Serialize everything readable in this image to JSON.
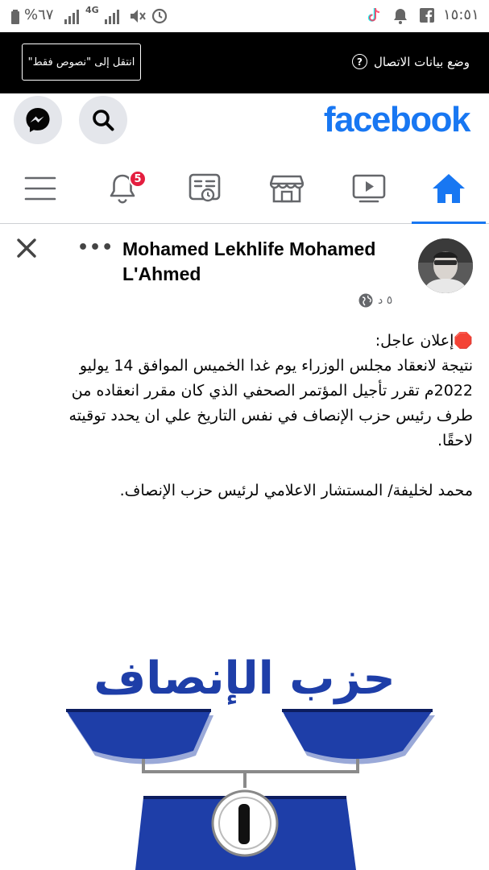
{
  "status_bar": {
    "time": "١٥:٥١",
    "battery": "%٦٧",
    "network": "4G"
  },
  "data_mode": {
    "label": "وضع بيانات الاتصال",
    "text_only_button": "انتقل إلى \"نصوص فقط\""
  },
  "header": {
    "logo": "facebook"
  },
  "nav": {
    "notifications_badge": "5",
    "active_tab": "home"
  },
  "post": {
    "author": "Mohamed Lekhlife Mohamed L'Ahmed",
    "timestamp": "٥ د",
    "lines": [
      "🛑إعلان عاجل:",
      "نتيجة لانعقاد مجلس الوزراء يوم غدا الخميس الموافق 14 يوليو",
      "2022م تقرر تأجيل المؤتمر الصحفي الذي كان مقرر انعقاده من",
      "طرف رئيس حزب الإنصاف في نفس التاريخ علي ان يحدد توقيته",
      "لاحقًا."
    ],
    "signature": "محمد لخليفة/ المستشار الاعلامي لرئيس حزب الإنصاف.",
    "image_title": "حزب الإنصاف"
  },
  "colors": {
    "brand": "#1877f2",
    "badge": "#e41e3f",
    "party_blue": "#1e3ea8"
  }
}
